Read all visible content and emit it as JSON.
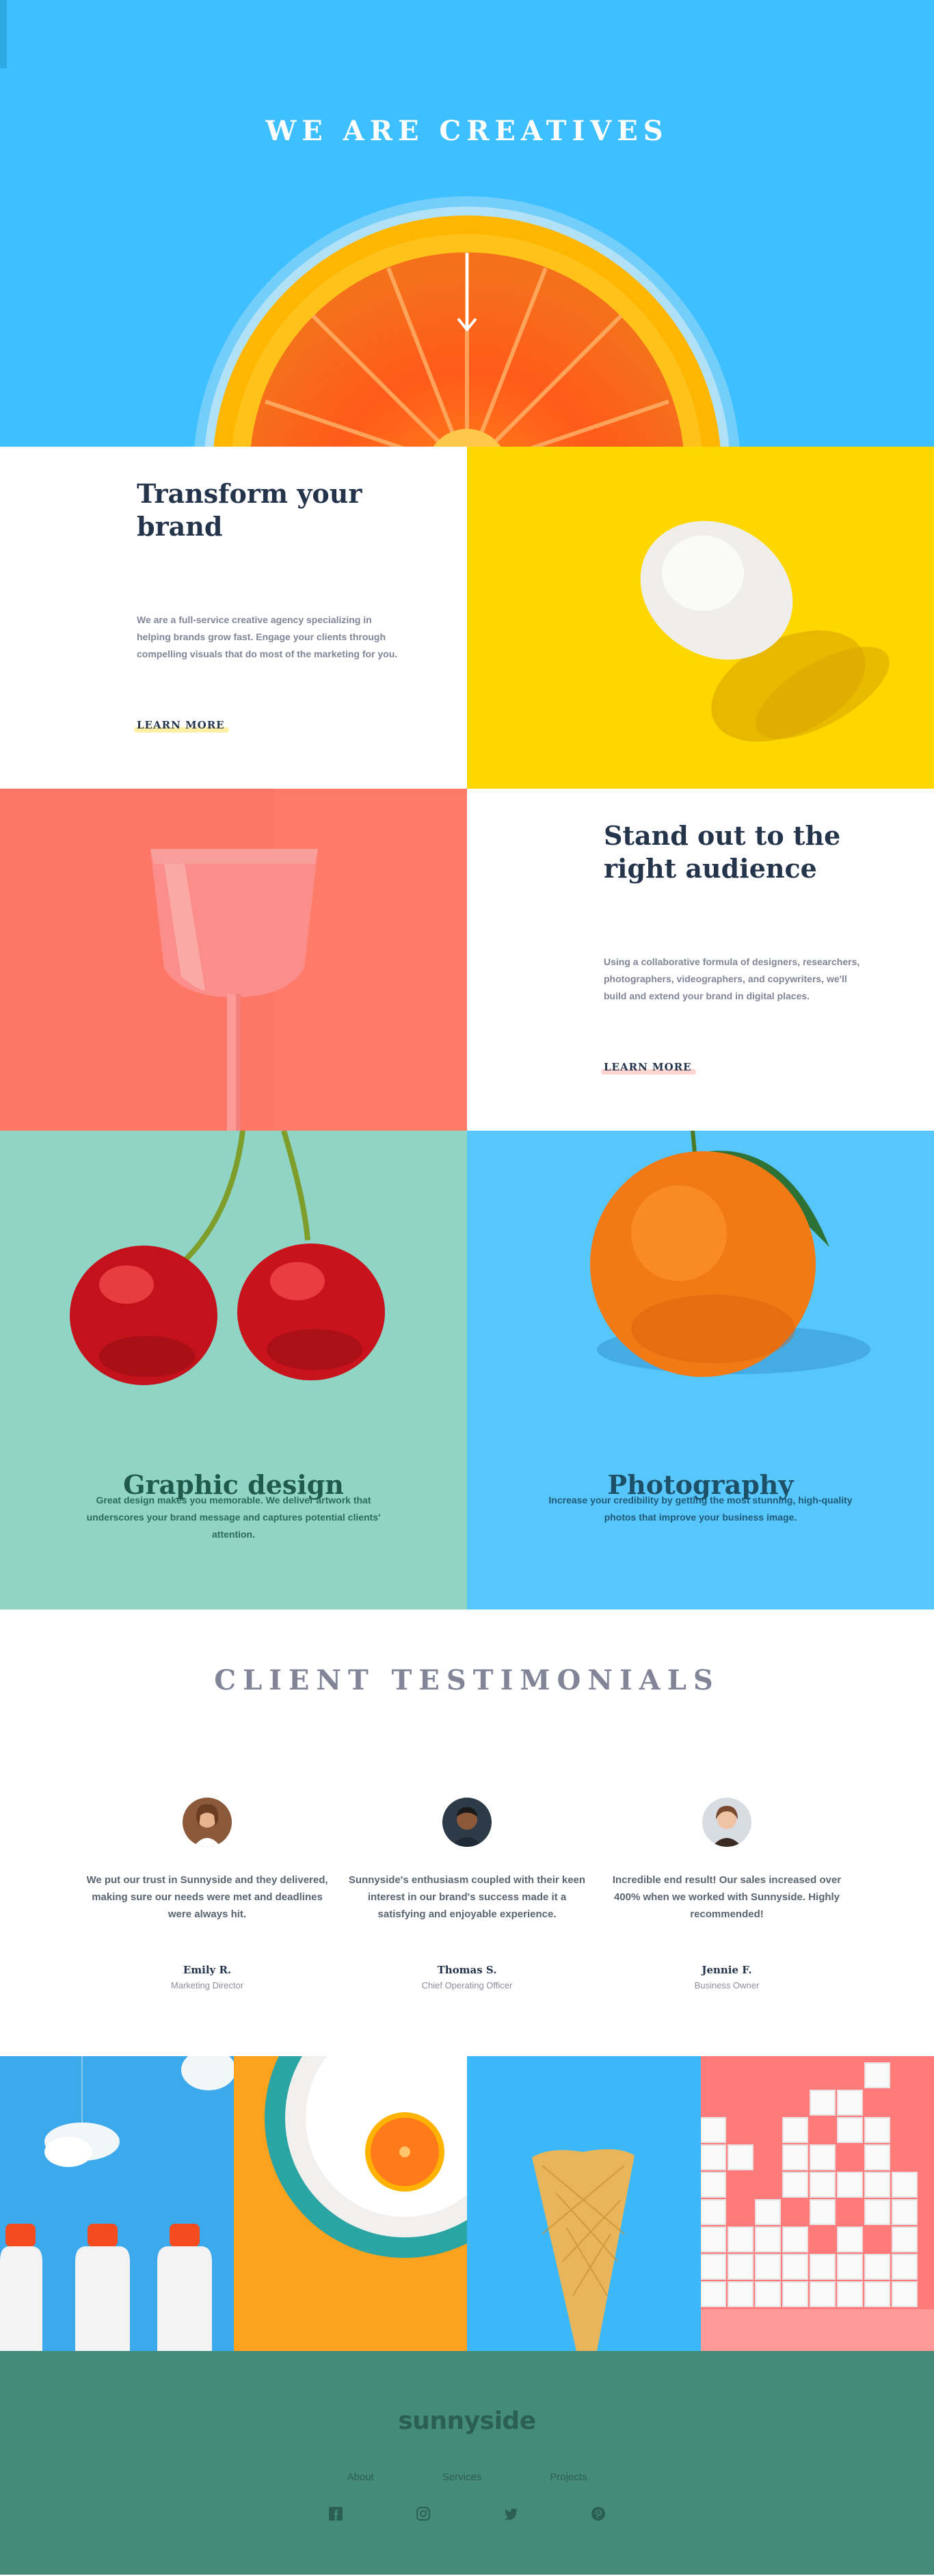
{
  "hero": {
    "title": "WE ARE CREATIVES"
  },
  "intro": {
    "title": "Transform your brand",
    "body": "We are a full-service creative agency specializing in helping brands grow fast. Engage your clients through compelling visuals that do most of the marketing for you.",
    "cta": "LEARN MORE",
    "cta_highlight": "#fad400"
  },
  "audience": {
    "title": "Stand out to the right audience",
    "body": "Using a collaborative formula of designers, researchers, photographers, videographers, and copywriters, we'll build and extend your brand in digital places.",
    "cta": "LEARN MORE",
    "cta_highlight": "#fe7766"
  },
  "graphic": {
    "title": "Graphic design",
    "body": "Great design makes you memorable. We deliver artwork that underscores your brand message and captures potential clients' attention."
  },
  "photography": {
    "title": "Photography",
    "body": "Increase your credibility by getting the most stunning, high-quality photos that improve your business image."
  },
  "testimonials": {
    "title": "CLIENT TESTIMONIALS",
    "items": [
      {
        "quote": "We put our trust in Sunnyside and they delivered, making sure our needs were met and deadlines were always hit.",
        "name": "Emily R.",
        "role": "Marketing Director",
        "avatar": "avatar-emily"
      },
      {
        "quote": "Sunnyside's enthusiasm coupled with their keen interest in our brand's success made it a satisfying and enjoyable experience.",
        "name": "Thomas S.",
        "role": "Chief Operating Officer",
        "avatar": "avatar-thomas"
      },
      {
        "quote": "Incredible end result! Our sales increased over 400% when we worked with Sunnyside. Highly recommended!",
        "name": "Jennie F.",
        "role": "Business Owner",
        "avatar": "avatar-jennie"
      }
    ]
  },
  "footer": {
    "logo": "sunnyside",
    "nav": [
      "About",
      "Services",
      "Projects"
    ],
    "social": [
      "facebook-icon",
      "instagram-icon",
      "twitter-icon",
      "pinterest-icon"
    ]
  },
  "colors": {
    "hero": "#3ebfff",
    "yellow": "#fed600",
    "coral": "#fe7766",
    "mint": "#90d4c5",
    "sky": "#57c6fb",
    "graphic_text": "#1f5a4b",
    "photo_text": "#1d4f66",
    "footer": "#458b7a"
  }
}
